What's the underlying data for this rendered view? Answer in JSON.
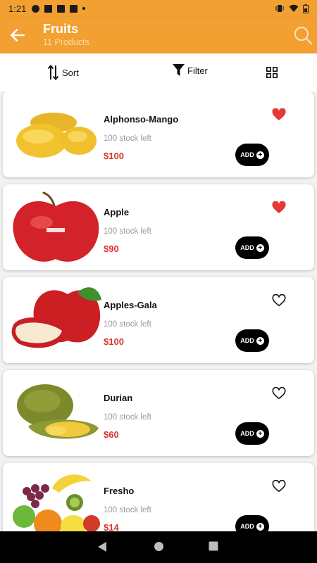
{
  "status_bar": {
    "time": "1:21"
  },
  "app_bar": {
    "title": "Fruits",
    "subtitle": "11 Products"
  },
  "toolbar": {
    "sort_label": "Sort",
    "filter_label": "Filter"
  },
  "products": [
    {
      "name": "Alphonso-Mango",
      "stock": "100 stock left",
      "price": "$100",
      "favorite": true,
      "add_label": "ADD"
    },
    {
      "name": "Apple",
      "stock": "100 stock left",
      "price": "$90",
      "favorite": true,
      "add_label": "ADD"
    },
    {
      "name": "Apples-Gala",
      "stock": "100 stock left",
      "price": "$100",
      "favorite": false,
      "add_label": "ADD"
    },
    {
      "name": "Durian",
      "stock": "100 stock left",
      "price": "$60",
      "favorite": false,
      "add_label": "ADD"
    },
    {
      "name": "Fresho",
      "stock": "100 stock left",
      "price": "$14",
      "favorite": false,
      "add_label": "ADD"
    }
  ],
  "colors": {
    "accent": "#f3a032",
    "price": "#d9362b",
    "favorite": "#e53935"
  }
}
